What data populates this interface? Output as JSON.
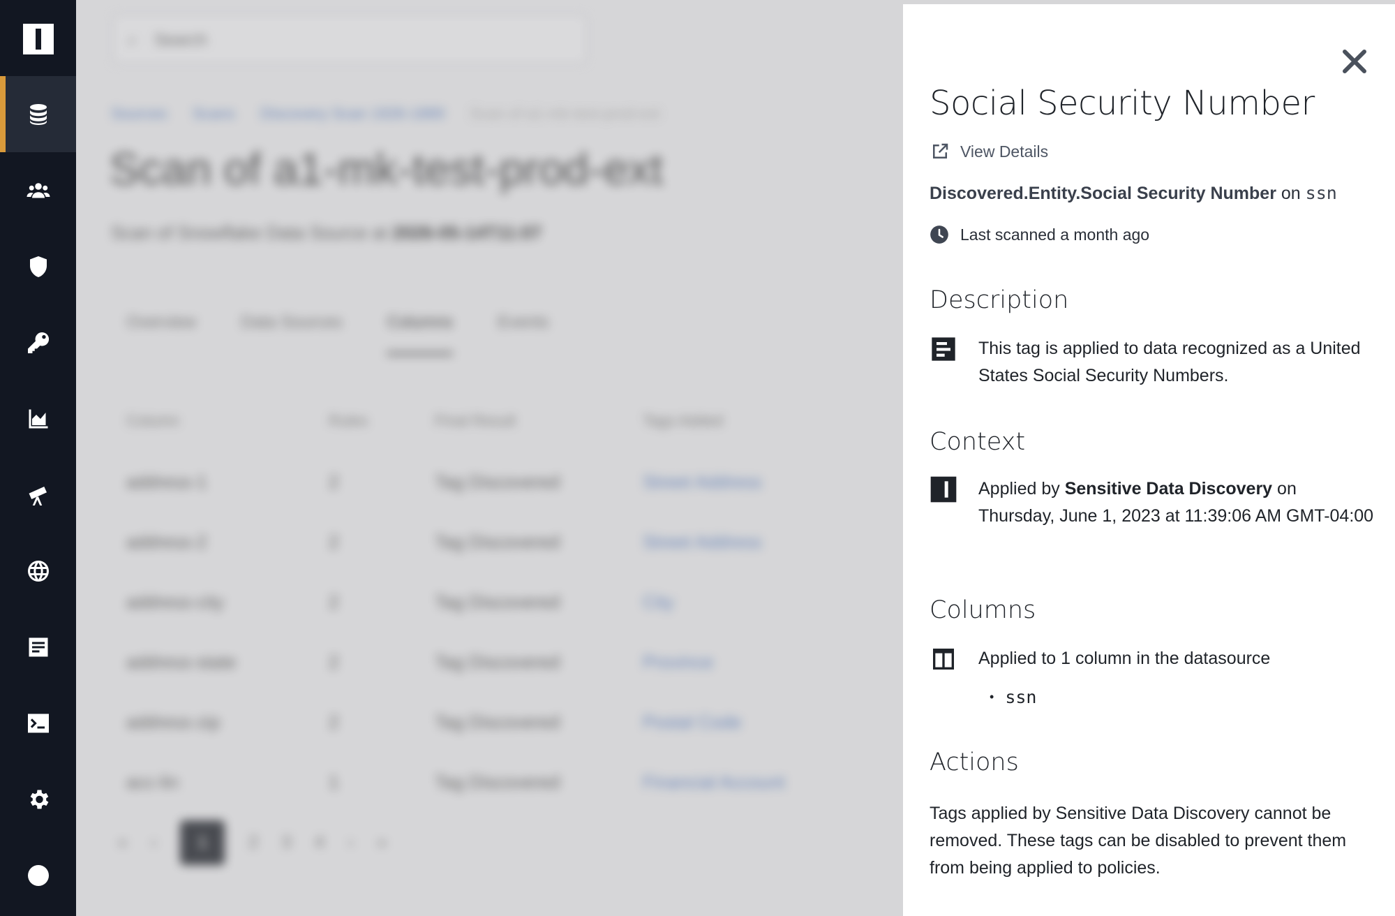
{
  "sidebar": {
    "logo": "I",
    "items": [
      {
        "icon": "database-icon",
        "active": true
      },
      {
        "icon": "users-icon"
      },
      {
        "icon": "shield-icon"
      },
      {
        "icon": "key-icon"
      },
      {
        "icon": "area-chart-icon"
      },
      {
        "icon": "telescope-icon"
      },
      {
        "icon": "globe-icon"
      },
      {
        "icon": "notes-icon"
      },
      {
        "icon": "terminal-icon"
      },
      {
        "icon": "gear-icon"
      },
      {
        "icon": "arrow-right-circle-icon"
      }
    ],
    "accent_color": "#d99a3b"
  },
  "background": {
    "search_placeholder": "Search",
    "breadcrumbs": [
      "Sources",
      "Scans",
      "Discovery Scan 1926-1889",
      "Scan of a1-mk-test-prod-ext"
    ],
    "title": "Scan of a1-mk-test-prod-ext",
    "subtitle_prefix": "Scan of Snowflake Data Source at",
    "subtitle_date": "2026-05-14T11:07",
    "tabs": [
      "Overview",
      "Data Sources",
      "Columns",
      "Events"
    ],
    "active_tab": "Columns",
    "columns": [
      "Column",
      "Rules",
      "Final Result",
      "Tags Added"
    ],
    "rows": [
      {
        "column": "address-1",
        "rules": "2",
        "result": "Tag Discovered",
        "tag": "Street Address"
      },
      {
        "column": "address-2",
        "rules": "2",
        "result": "Tag Discovered",
        "tag": "Street Address"
      },
      {
        "column": "address-city",
        "rules": "2",
        "result": "Tag Discovered",
        "tag": "City"
      },
      {
        "column": "address-state",
        "rules": "2",
        "result": "Tag Discovered",
        "tag": "Province"
      },
      {
        "column": "address-zip",
        "rules": "2",
        "result": "Tag Discovered",
        "tag": "Postal Code"
      },
      {
        "column": "acc-lin",
        "rules": "1",
        "result": "Tag Discovered",
        "tag": "Financial Account"
      }
    ],
    "pager": [
      "«",
      "‹",
      "1",
      "2",
      "3",
      "4",
      "›",
      "»"
    ],
    "current_page": "1"
  },
  "drawer": {
    "title": "Social Security Number",
    "view_details": "View Details",
    "entity_name": "Discovered.Entity.Social Security Number",
    "entity_on": "on",
    "entity_column": "ssn",
    "last_scanned": "Last scanned a month ago",
    "description_heading": "Description",
    "description_text": "This tag is applied to data recognized as a United States Social Security Numbers.",
    "context_heading": "Context",
    "context_prefix": "Applied by",
    "context_source": "Sensitive Data Discovery",
    "context_suffix": "on Thursday, June 1, 2023 at 11:39:06 AM GMT-04:00",
    "columns_heading": "Columns",
    "columns_text": "Applied to 1 column in the datasource",
    "columns_list": [
      "ssn"
    ],
    "actions_heading": "Actions",
    "actions_text": "Tags applied by Sensitive Data Discovery cannot be removed. These tags can be disabled to prevent them from being applied to policies."
  }
}
